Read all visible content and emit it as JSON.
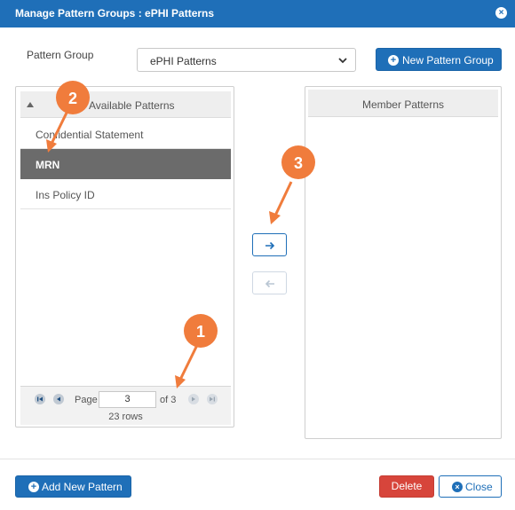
{
  "dialog": {
    "title": "Manage Pattern Groups : ePHI Patterns"
  },
  "pattern_group": {
    "label": "Pattern Group",
    "selected": "ePHI Patterns",
    "new_button": "New Pattern Group"
  },
  "available": {
    "header": "Available Patterns",
    "items": [
      {
        "label": "Confidential Statement",
        "selected": false
      },
      {
        "label": "MRN",
        "selected": true
      },
      {
        "label": "Ins Policy ID",
        "selected": false
      }
    ],
    "pager": {
      "page_label": "Page",
      "page_value": "3",
      "of_label": "of 3",
      "rows_label": "23 rows"
    }
  },
  "member": {
    "header": "Member Patterns"
  },
  "footer": {
    "add_new": "Add New Pattern",
    "delete": "Delete",
    "close": "Close"
  },
  "annotations": {
    "badge1": "1",
    "badge2": "2",
    "badge3": "3"
  },
  "colors": {
    "primary": "#1f6fb8",
    "danger": "#d7453b",
    "selected_row": "#6b6b6b",
    "annotation": "#f07c3c"
  }
}
